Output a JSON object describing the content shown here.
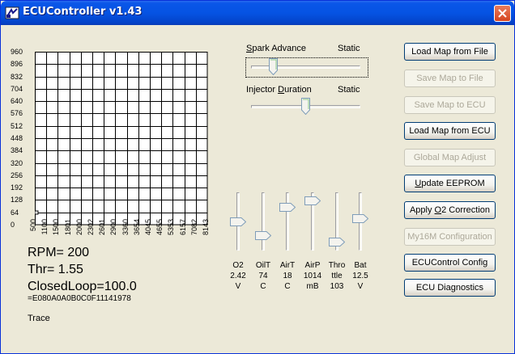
{
  "window": {
    "title": "ECUController v1.43"
  },
  "map": {
    "y_labels": [
      "960",
      "896",
      "832",
      "704",
      "640",
      "576",
      "512",
      "448",
      "384",
      "320",
      "256",
      "192",
      "128",
      "64",
      "0"
    ],
    "x_labels": [
      "500",
      "1100",
      "1500",
      "1801",
      "2000",
      "2302",
      "2601",
      "2900",
      "3360",
      "3654",
      "4045",
      "4655",
      "5353",
      "6157",
      "7082",
      "8143"
    ]
  },
  "status": {
    "rpm": "RPM= 200",
    "thr": "Thr= 1.55",
    "closed_loop": "ClosedLoop=100.0",
    "hex": "=E080A0A0B0C0F11141978",
    "trace": "Trace"
  },
  "spark": {
    "label": "Spark Advance",
    "state": "Static",
    "position": 0.18
  },
  "injector": {
    "label": "Injector Duration",
    "state": "Static",
    "position": 0.5
  },
  "gauges": [
    {
      "name": "O2",
      "value": "2.42",
      "unit": "V",
      "level": 0.5
    },
    {
      "name": "OilT",
      "value": "74",
      "unit": "C",
      "level": 0.22
    },
    {
      "name": "AirT",
      "value": "18",
      "unit": "C",
      "level": 0.78
    },
    {
      "name": "AirP",
      "value": "1014",
      "unit": "mB",
      "level": 0.92
    },
    {
      "name": "Thro",
      "value": "ttle",
      "unit": "103",
      "level": 0.08
    },
    {
      "name": "Bat",
      "value": "12.5",
      "unit": "V",
      "level": 0.55
    }
  ],
  "buttons": {
    "load_file": "Load Map from File",
    "save_file": "Save Map to File",
    "save_ecu": "Save Map to ECU",
    "load_ecu": "Load Map from ECU",
    "global_adjust": "Global Map Adjust",
    "update_eeprom": "Update EEPROM",
    "apply_o2": "Apply O2 Correction",
    "my16m": "My16M Configuration",
    "ecucontrol_config": "ECUControl Config",
    "diagnostics": "ECU Diagnostics"
  }
}
